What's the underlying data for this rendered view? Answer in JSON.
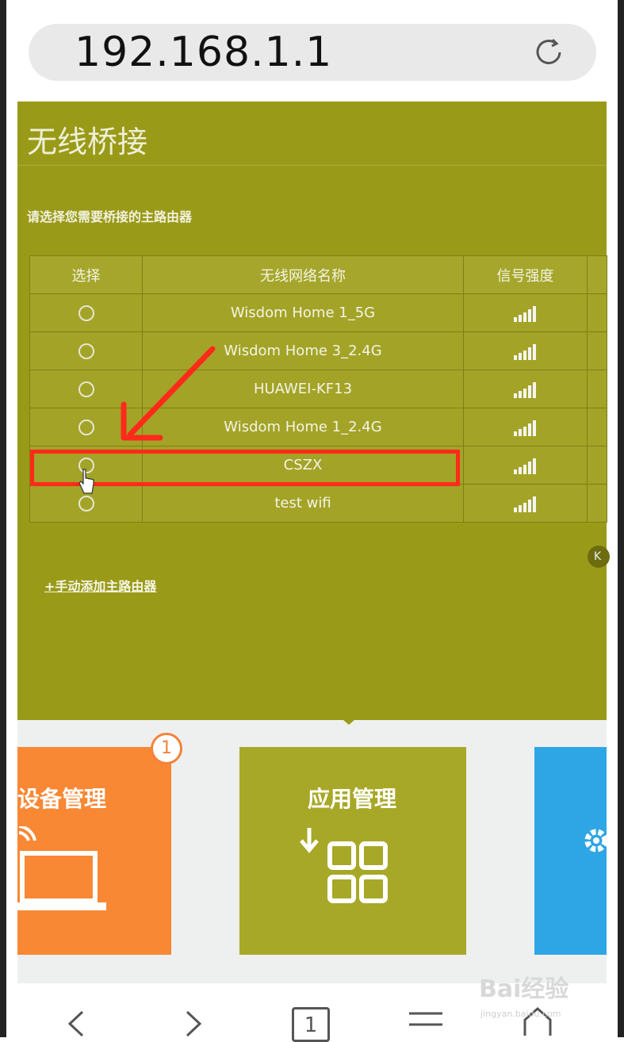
{
  "browser": {
    "url": "192.168.1.1",
    "tab_count": "1"
  },
  "page": {
    "title": "无线桥接",
    "instruction": "请选择您需要桥接的主路由器",
    "add_router_link": "+手动添加主路由器",
    "side_knob": "K"
  },
  "table": {
    "headers": [
      "选择",
      "无线网络名称",
      "信号强度"
    ],
    "rows": [
      {
        "ssid": "Wisdom Home 1_5G"
      },
      {
        "ssid": "Wisdom Home 3_2.4G"
      },
      {
        "ssid": "HUAWEI-KF13"
      },
      {
        "ssid": "Wisdom Home 1_2.4G"
      },
      {
        "ssid": "CSZX"
      },
      {
        "ssid": "test wifi"
      }
    ]
  },
  "tiles": {
    "device_mgmt": "设备管理",
    "device_badge": "1",
    "app_mgmt": "应用管理"
  },
  "watermark": {
    "brand": "Bai经验",
    "site": "jingyan.baidu.com"
  },
  "colors": {
    "page_bg": "#9a9a19",
    "highlight": "#ff2a1a",
    "tile_orange": "#f88834",
    "tile_olive": "#a8a828",
    "tile_blue": "#2ea6e6"
  }
}
